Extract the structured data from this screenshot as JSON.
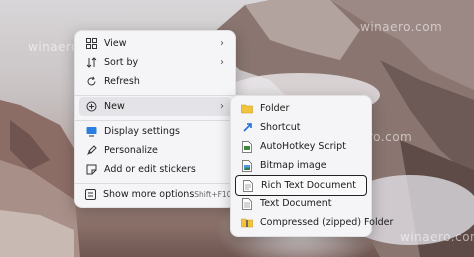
{
  "watermarks": [
    "winaero.com",
    "winaero.com",
    "winaero.com",
    "winaero.com"
  ],
  "context_menu": {
    "items": [
      {
        "label": "View",
        "icon": "grid-icon",
        "has_submenu": true
      },
      {
        "label": "Sort by",
        "icon": "sort-icon",
        "has_submenu": true
      },
      {
        "label": "Refresh",
        "icon": "refresh-icon"
      },
      {
        "label": "New",
        "icon": "plus-circle-icon",
        "has_submenu": true
      },
      {
        "label": "Display settings",
        "icon": "display-icon"
      },
      {
        "label": "Personalize",
        "icon": "brush-icon"
      },
      {
        "label": "Add or edit stickers",
        "icon": "sticker-icon"
      },
      {
        "label": "Show more options",
        "icon": "more-options-icon",
        "shortcut": "Shift+F10"
      }
    ]
  },
  "new_submenu": {
    "items": [
      {
        "label": "Folder",
        "icon": "folder-icon"
      },
      {
        "label": "Shortcut",
        "icon": "shortcut-icon"
      },
      {
        "label": "AutoHotkey Script",
        "icon": "ahk-icon"
      },
      {
        "label": "Bitmap image",
        "icon": "bitmap-icon"
      },
      {
        "label": "Rich Text Document",
        "icon": "rtf-document-icon"
      },
      {
        "label": "Text Document",
        "icon": "text-document-icon"
      },
      {
        "label": "Compressed (zipped) Folder",
        "icon": "zip-folder-icon"
      }
    ]
  }
}
